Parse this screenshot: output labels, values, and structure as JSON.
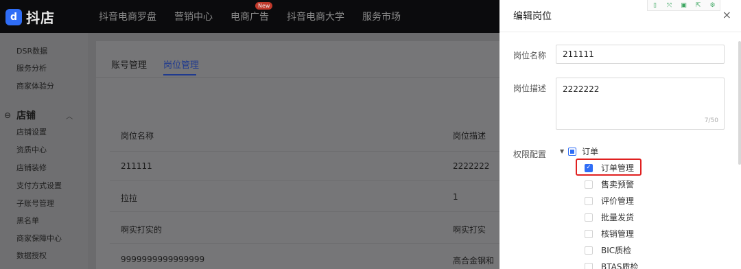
{
  "app": {
    "logo_text": "抖店",
    "logo_glyph": "d"
  },
  "nav": {
    "items": [
      {
        "label": "抖音电商罗盘"
      },
      {
        "label": "营销中心"
      },
      {
        "label": "电商广告",
        "badge": "New"
      },
      {
        "label": "抖音电商大学"
      },
      {
        "label": "服务市场"
      }
    ]
  },
  "sidebar": {
    "top_items": [
      "DSR数据",
      "服务分析",
      "商家体验分"
    ],
    "section": {
      "label": "店铺",
      "icon": "shop-icon"
    },
    "items": [
      "店铺设置",
      "资质中心",
      "店铺装修",
      "支付方式设置",
      "子账号管理",
      "黑名单",
      "商家保障中心",
      "数据授权"
    ]
  },
  "main": {
    "tabs": [
      {
        "label": "账号管理",
        "active": false
      },
      {
        "label": "岗位管理",
        "active": true
      }
    ],
    "table": {
      "columns": [
        "岗位名称",
        "岗位描述"
      ],
      "rows": [
        [
          "211111",
          "2222222"
        ],
        [
          "拉拉",
          "1"
        ],
        [
          "啊实打实的",
          "啊实打实"
        ],
        [
          "9999999999999999",
          "高合金钢和"
        ]
      ]
    }
  },
  "drawer": {
    "title": "编辑岗位",
    "close_glyph": "×",
    "fields": {
      "name_label": "岗位名称",
      "name_value": "211111",
      "desc_label": "岗位描述",
      "desc_value": "2222222",
      "desc_counter": "7/50",
      "perm_label": "权限配置"
    },
    "tree": {
      "root": {
        "label": "订单",
        "state": "indeterminate"
      },
      "children": [
        {
          "label": "订单管理",
          "checked": true
        },
        {
          "label": "售卖预警",
          "checked": false
        },
        {
          "label": "评价管理",
          "checked": false
        },
        {
          "label": "批量发货",
          "checked": false
        },
        {
          "label": "核销管理",
          "checked": false
        },
        {
          "label": "BIC质检",
          "checked": false
        },
        {
          "label": "BTAS质检",
          "checked": false
        }
      ]
    },
    "toolbar_icons": [
      "bookmark-icon",
      "expand-icon",
      "save-icon",
      "share-icon",
      "settings-icon"
    ]
  },
  "colors": {
    "accent": "#2f6df6",
    "highlight": "#e02020",
    "active_tab": "#1f3a8f"
  }
}
